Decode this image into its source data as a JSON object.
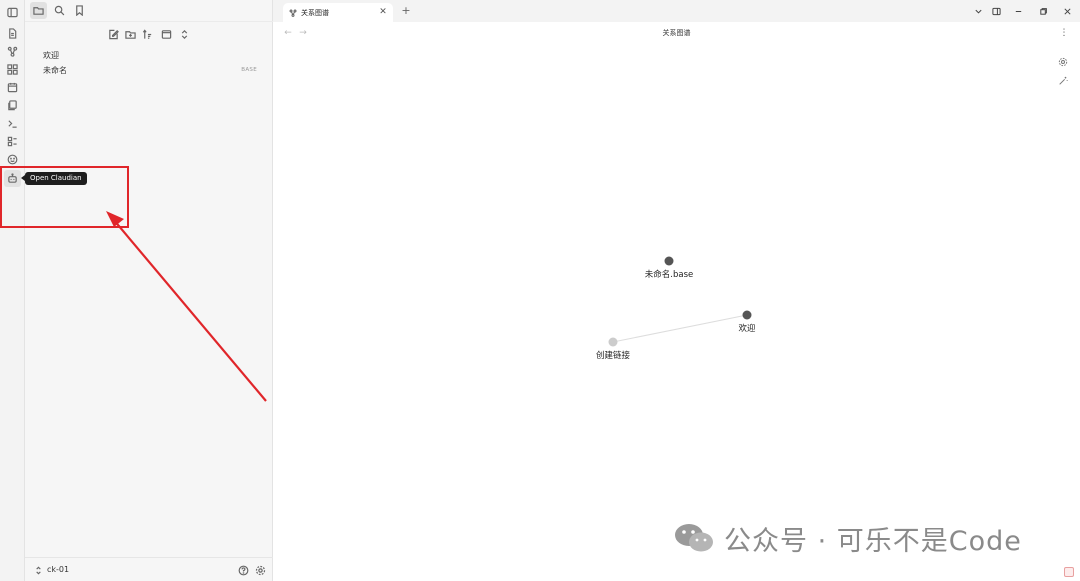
{
  "sidebar": {
    "files": [
      {
        "name": "欢迎",
        "badge": ""
      },
      {
        "name": "未命名",
        "badge": "BASE"
      }
    ],
    "vault_name": "ck-01"
  },
  "tooltip": {
    "text": "Open Claudian"
  },
  "tab": {
    "label": "关系图谱"
  },
  "view": {
    "title": "关系图谱"
  },
  "graph": {
    "nodes": [
      {
        "id": "base",
        "label": "未命名.base",
        "color": "#555555"
      },
      {
        "id": "welcome",
        "label": "欢迎",
        "color": "#555555"
      },
      {
        "id": "link",
        "label": "创建链接",
        "color": "#cccccc"
      }
    ],
    "edges": [
      [
        "link",
        "welcome"
      ]
    ]
  },
  "watermark": {
    "text": "公众号 · 可乐不是Code"
  },
  "colors": {
    "annotation": "#e0262a",
    "ribbon_bg": "#f3f3f3",
    "sidebar_bg": "#f6f6f6"
  }
}
